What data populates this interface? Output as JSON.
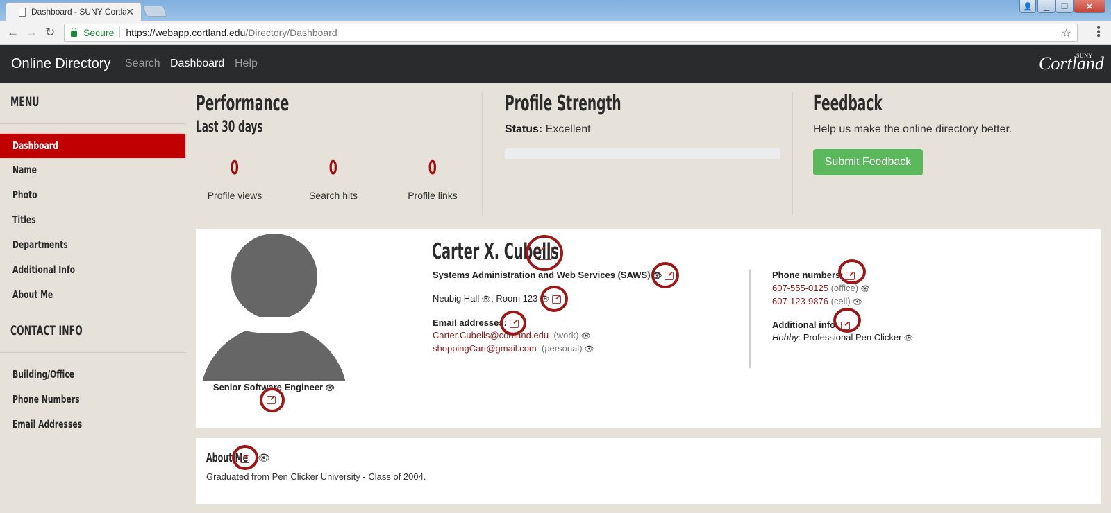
{
  "browser": {
    "tab_title": "Dashboard - SUNY Cortla",
    "secure_label": "Secure",
    "url_host": "https://webapp.cortland.edu",
    "url_path": "/Directory/Dashboard"
  },
  "nav": {
    "brand": "Online Directory",
    "links": [
      {
        "label": "Search",
        "active": false
      },
      {
        "label": "Dashboard",
        "active": true
      },
      {
        "label": "Help",
        "active": false
      }
    ],
    "logo_main": "Cortland",
    "logo_sup": "SUNY"
  },
  "sidebar": {
    "menu_heading": "MENU",
    "menu_items": [
      {
        "label": "Dashboard",
        "active": true
      },
      {
        "label": "Name"
      },
      {
        "label": "Photo"
      },
      {
        "label": "Titles"
      },
      {
        "label": "Departments"
      },
      {
        "label": "Additional Info"
      },
      {
        "label": "About Me"
      }
    ],
    "contact_heading": "CONTACT INFO",
    "contact_items": [
      {
        "label": "Building/Office"
      },
      {
        "label": "Phone Numbers"
      },
      {
        "label": "Email Addresses"
      }
    ]
  },
  "performance": {
    "title": "Performance",
    "subtitle": "Last 30 days",
    "stats": [
      {
        "value": "0",
        "label": "Profile views"
      },
      {
        "value": "0",
        "label": "Search hits"
      },
      {
        "value": "0",
        "label": "Profile links"
      }
    ]
  },
  "profile_strength": {
    "title": "Profile Strength",
    "status_label": "Status:",
    "status_value": "Excellent",
    "progress_percent": 0
  },
  "feedback": {
    "title": "Feedback",
    "text": "Help us make the online directory better.",
    "button_label": "Submit Feedback"
  },
  "profile": {
    "name": "Carter X. Cubells",
    "job_title": "Senior Software Engineer",
    "department": "Systems Administration and Web Services (SAWS)",
    "building": "Neubig Hall",
    "room": ", Room 123",
    "email_heading": "Email addresses:",
    "emails": [
      {
        "address": "Carter.Cubells@cortland.edu",
        "type": "(work)"
      },
      {
        "address": "shoppingCart@gmail.com",
        "type": "(personal)"
      }
    ],
    "phone_heading": "Phone numbers:",
    "phones": [
      {
        "number": "607-555-0125",
        "type": "(office)"
      },
      {
        "number": "607-123-9876",
        "type": "(cell)"
      }
    ],
    "additional_heading": "Additional info:",
    "additional": {
      "key": "Hobby",
      "value": ": Professional Pen Clicker"
    }
  },
  "about": {
    "title": "About Me",
    "text": "Graduated from Pen Clicker University - Class of 2004."
  },
  "colors": {
    "accent_red": "#c00000",
    "link_red": "#8a1c1c",
    "success_green": "#5cb85c",
    "nav_bg": "#2a2b2d",
    "page_bg": "#e7e2d9",
    "annotation_circle": "#9a1818"
  }
}
